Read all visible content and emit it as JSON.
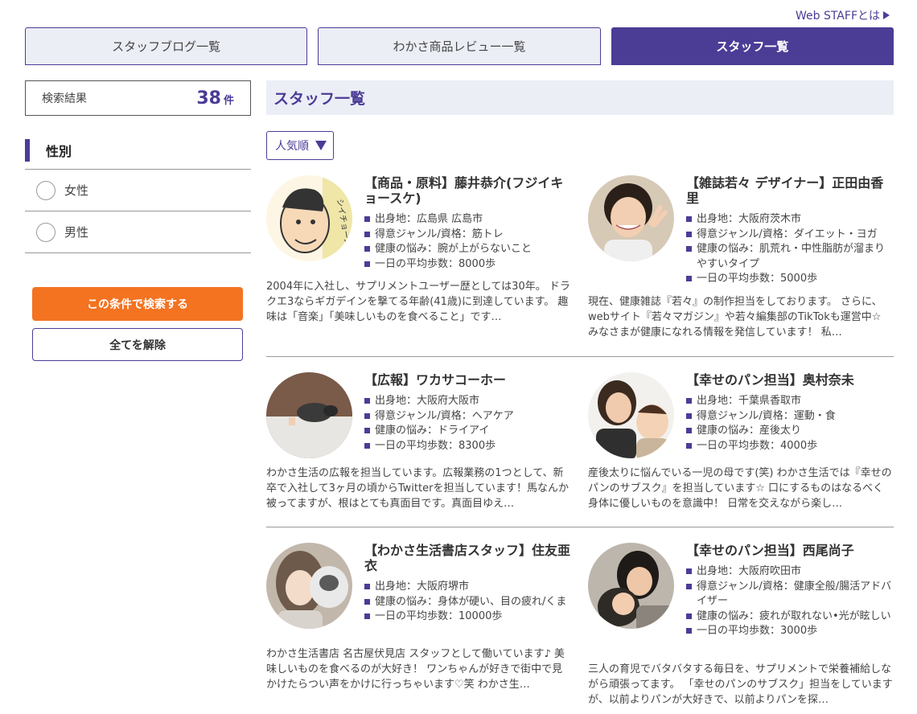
{
  "header": {
    "web_staff_link": "Web STAFFとは"
  },
  "tabs": [
    {
      "label": "スタッフブログ一覧",
      "active": false
    },
    {
      "label": "わかさ商品レビュー一覧",
      "active": false
    },
    {
      "label": "スタッフ一覧",
      "active": true
    }
  ],
  "sidebar": {
    "result_label": "検索結果",
    "result_count": "38",
    "result_unit": "件",
    "filter_title": "性別",
    "options": [
      {
        "label": "女性"
      },
      {
        "label": "男性"
      }
    ],
    "search_button": "この条件で検索する",
    "clear_button": "全てを解除"
  },
  "main": {
    "title": "スタッフ一覧",
    "sort_label": "人気順"
  },
  "staff": [
    {
      "name": "【商品・原料】藤井恭介(フジイキョースケ)",
      "facts": [
        "出身地：広島県 広島市",
        "得意ジャンル/資格：筋トレ",
        "健康の悩み：腕が上がらないこと",
        "一日の平均歩数：8000歩"
      ],
      "desc": "2004年に入社し、サプリメントユーザー歴としては30年。 ドラクエ3ならギガデインを撃てる年齢(41歳)に到達しています。 趣味は「音楽」「美味しいものを食べること」です…",
      "avatar_text": "シイチョースケ"
    },
    {
      "name": "【雑誌若々 デザイナー】正田由香里",
      "facts": [
        "出身地：大阪府茨木市",
        "得意ジャンル/資格：ダイエット・ヨガ",
        "健康の悩み：肌荒れ・中性脂肪が溜まりやすいタイプ",
        "一日の平均歩数：5000歩"
      ],
      "desc": "現在、健康雑誌『若々』の制作担当をしております。 さらに、webサイト『若々マガジン』や若々編集部のTikTokも運営中☆ みなさまが健康になれる情報を発信しています！ 私…"
    },
    {
      "name": "【広報】ワカサコーホー",
      "facts": [
        "出身地：大阪府大阪市",
        "得意ジャンル/資格：ヘアケア",
        "健康の悩み：ドライアイ",
        "一日の平均歩数：8300歩"
      ],
      "desc": "わかさ生活の広報を担当しています。広報業務の1つとして、新卒で入社して3ヶ月の頃からTwitterを担当しています！馬なんか被ってますが、根はとても真面目です。真面目ゆえ…"
    },
    {
      "name": "【幸せのパン担当】奥村奈未",
      "facts": [
        "出身地：千葉県香取市",
        "得意ジャンル/資格：運動・食",
        "健康の悩み：産後太り",
        "一日の平均歩数：4000歩"
      ],
      "desc": "産後太りに悩んでいる一児の母です(笑) わかさ生活では『幸せのパンのサブスク』を担当しています☆ 口にするものはなるべく身体に優しいものを意識中！ 日常を交えながら楽し…"
    },
    {
      "name": "【わかさ生活書店スタッフ】住友亜衣",
      "facts": [
        "出身地：大阪府堺市",
        "健康の悩み：身体が硬い、目の疲れ/くま",
        "一日の平均歩数：10000歩"
      ],
      "desc": "わかさ生活書店 名古屋伏見店 スタッフとして働いています♪ 美味しいものを食べるのが大好き！ ワンちゃんが好きで街中で見かけたらつい声をかけに行っちゃいます♡笑 わかさ生…"
    },
    {
      "name": "【幸せのパン担当】西尾尚子",
      "facts": [
        "出身地：大阪府吹田市",
        "得意ジャンル/資格：健康全般/腸活アドバイザー",
        "健康の悩み：疲れが取れない•光が眩しい",
        "一日の平均歩数：3000歩"
      ],
      "desc": "三人の育児でバタバタする毎日を、サプリメントで栄養補給しながら頑張ってます。 「幸せのパンのサブスク」担当をしていますが、以前よりパンが大好きで、以前よりパンを探…"
    }
  ]
}
